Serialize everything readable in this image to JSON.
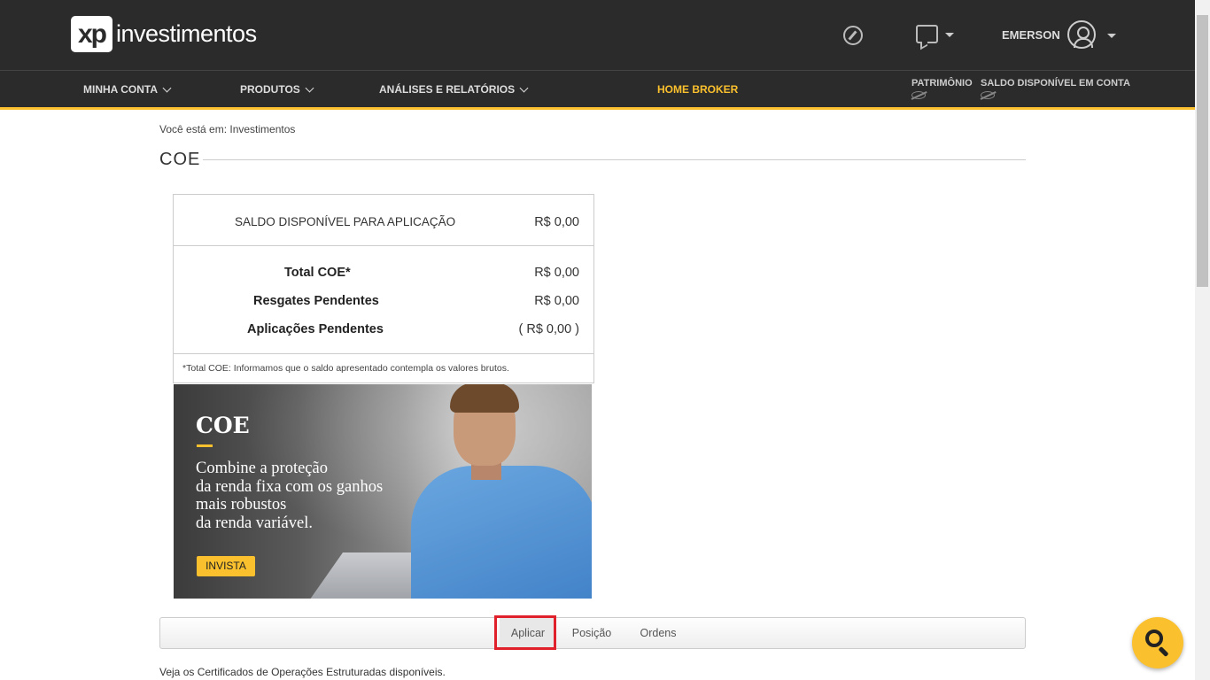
{
  "header": {
    "logo_mark": "xp",
    "logo_text": "investimentos",
    "user_name": "EMERSON"
  },
  "nav": {
    "items": [
      {
        "label": "MINHA CONTA"
      },
      {
        "label": "PRODUTOS"
      },
      {
        "label": "ANÁLISES E RELATÓRIOS"
      }
    ],
    "home_broker": "HOME BROKER",
    "patrimonio": "PATRIMÔNIO",
    "saldo_conta": "SALDO DISPONÍVEL EM CONTA",
    "accent_color": "#fbc02d"
  },
  "page": {
    "breadcrumb": "Você está em: Investimentos",
    "title": "COE"
  },
  "balance": {
    "available_label": "SALDO DISPONÍVEL PARA APLICAÇÃO",
    "available_value": "R$ 0,00",
    "rows": [
      {
        "label": "Total COE*",
        "value": "R$ 0,00"
      },
      {
        "label": "Resgates Pendentes",
        "value": "R$ 0,00"
      },
      {
        "label": "Aplicações Pendentes",
        "value": "( R$ 0,00 )"
      }
    ],
    "note": "*Total COE: Informamos que o saldo apresentado contempla os valores brutos."
  },
  "banner": {
    "title": "COE",
    "lines": [
      "Combine a proteção",
      "da renda fixa com os ganhos",
      "mais robustos",
      "da renda variável."
    ],
    "cta": "INVISTA"
  },
  "tabs": [
    {
      "label": "Aplicar",
      "active": true
    },
    {
      "label": "Posição",
      "active": false
    },
    {
      "label": "Ordens",
      "active": false
    }
  ],
  "info_text": "Veja os Certificados de Operações Estruturadas disponíveis."
}
